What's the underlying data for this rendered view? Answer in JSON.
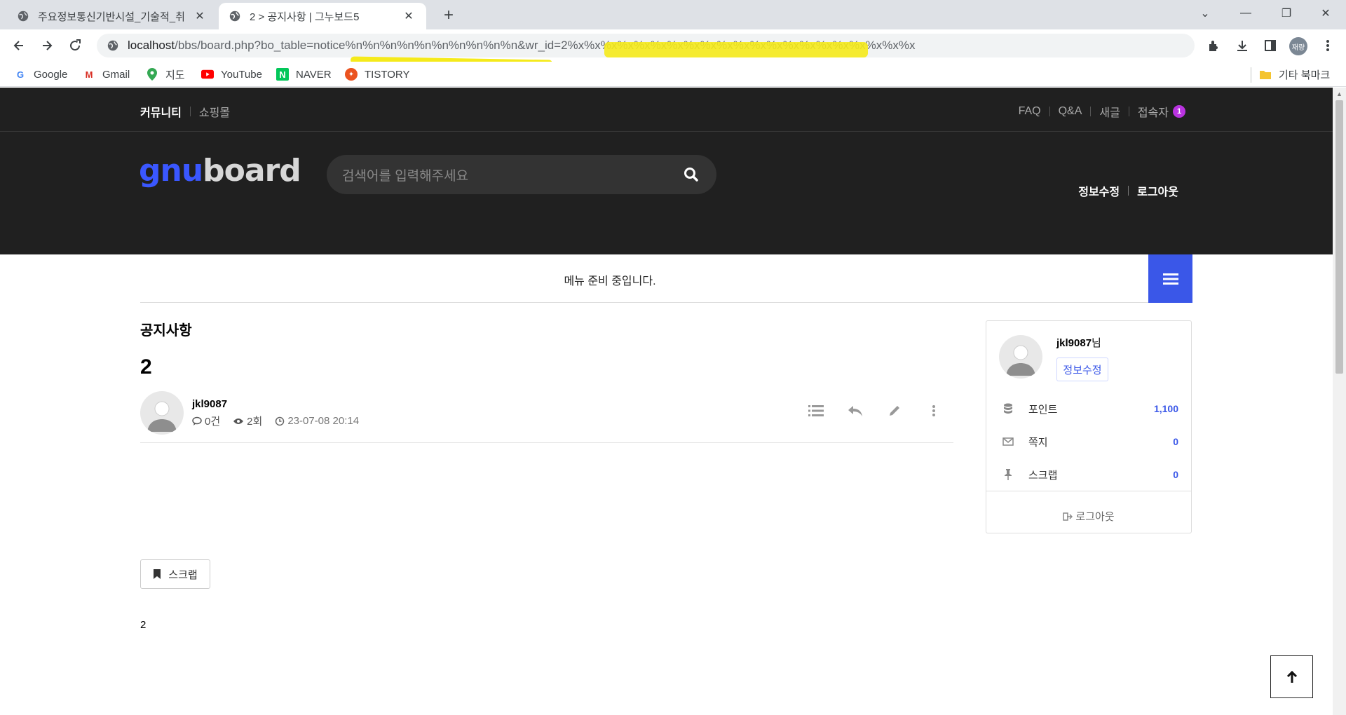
{
  "browser": {
    "tabs": [
      {
        "title": "주요정보통신기반시설_기술적_취",
        "active": false
      },
      {
        "title": "2 > 공지사항 | 그누보드5",
        "active": true
      }
    ],
    "url_host": "localhost",
    "url_rest": "/bbs/board.php?bo_table=notice%n%n%n%n%n%n%n%n%n%n&wr_id=2%x%x%x%x%x%x%x%x%x%x%x%x%x%x%x%x%x%x%x%x%x",
    "profile_label": "재량",
    "bookmarks": [
      "Google",
      "Gmail",
      "지도",
      "YouTube",
      "NAVER",
      "TISTORY"
    ],
    "other_bookmarks": "기타 북마크",
    "highlight_color": "#f5ea1b"
  },
  "site": {
    "top_left": {
      "community": "커뮤니티",
      "shop": "쇼핑몰"
    },
    "top_right": {
      "faq": "FAQ",
      "qa": "Q&A",
      "new": "새글",
      "visitors": "접속자",
      "visitor_count": "1"
    },
    "logo": {
      "part1": "gnu",
      "part2": "board"
    },
    "search_placeholder": "검색어를 입력해주세요",
    "header_links": {
      "edit_info": "정보수정",
      "logout": "로그아웃"
    },
    "gnb_message": "메뉴 준비 중입니다.",
    "accent_color": "#3a57e8"
  },
  "post": {
    "board_title": "공지사항",
    "title": "2",
    "author": "jkl9087",
    "comments": "0건",
    "views": "2회",
    "date": "23-07-08 20:14",
    "scrap_label": "스크랩",
    "body": "2"
  },
  "sidebar": {
    "username": "jkl9087",
    "honorific": "님",
    "edit_label": "정보수정",
    "rows": [
      {
        "icon": "database-icon",
        "label": "포인트",
        "value": "1,100"
      },
      {
        "icon": "envelope-icon",
        "label": "쪽지",
        "value": "0"
      },
      {
        "icon": "pin-icon",
        "label": "스크랩",
        "value": "0"
      }
    ],
    "logout_label": "로그아웃"
  }
}
